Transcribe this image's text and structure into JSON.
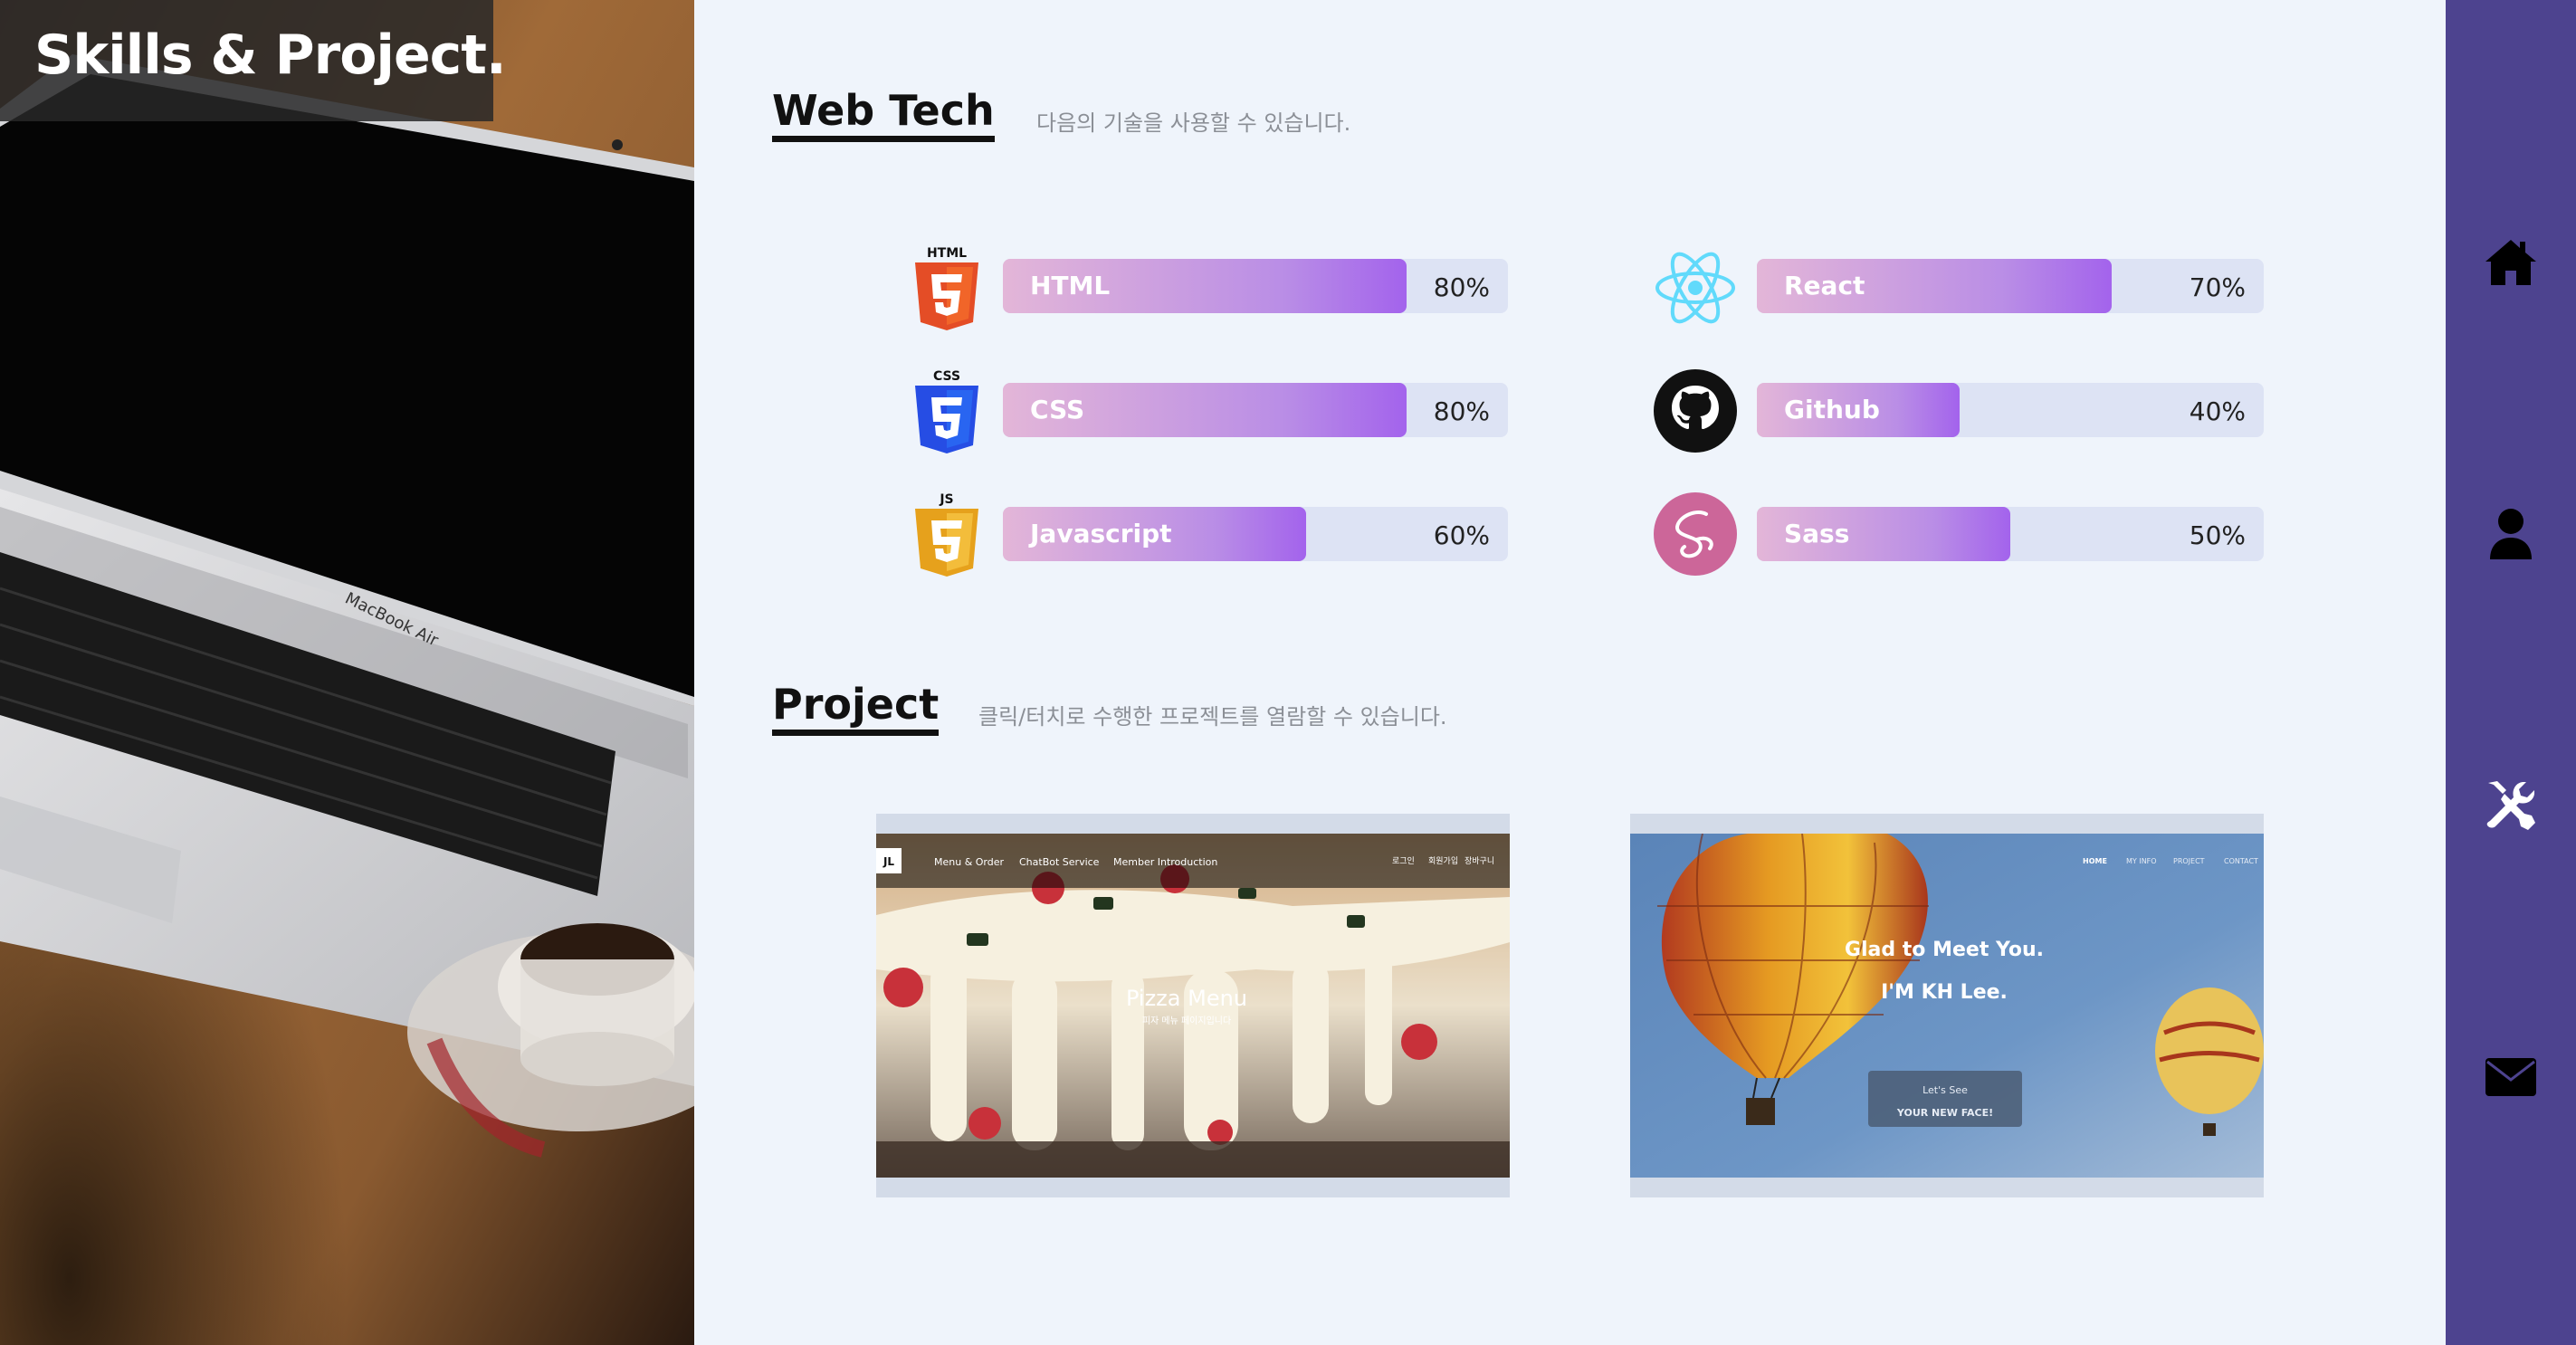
{
  "hero": {
    "title": "Skills & Project.",
    "laptop_brand": "MacBook Air"
  },
  "webtech": {
    "heading": "Web Tech",
    "subtitle": "다음의 기술을 사용할 수 있습니다.",
    "skills": [
      {
        "name": "HTML",
        "percent": "80%",
        "value": 0.8,
        "icon": "html5-icon",
        "icon_label": "HTML",
        "icon_color": "#e44d26"
      },
      {
        "name": "CSS",
        "percent": "80%",
        "value": 0.8,
        "icon": "css3-icon",
        "icon_label": "CSS",
        "icon_color": "#264de4"
      },
      {
        "name": "Javascript",
        "percent": "60%",
        "value": 0.6,
        "icon": "javascript-icon",
        "icon_label": "JS",
        "icon_color": "#f0b429"
      },
      {
        "name": "React",
        "percent": "70%",
        "value": 0.7,
        "icon": "react-icon",
        "icon_color": "#61dafb"
      },
      {
        "name": "Github",
        "percent": "40%",
        "value": 0.4,
        "icon": "github-icon",
        "icon_color": "#111111"
      },
      {
        "name": "Sass",
        "percent": "50%",
        "value": 0.5,
        "icon": "sass-icon",
        "icon_color": "#cc6699"
      }
    ]
  },
  "project": {
    "heading": "Project",
    "subtitle": "클릭/터치로 수행한 프로젝트를 열람할 수 있습니다.",
    "cards": [
      {
        "name": "pizza",
        "logo": "JL",
        "nav": [
          "Menu & Order",
          "ChatBot Service",
          "Member Introduction"
        ],
        "nav_right": [
          "로그인",
          "회원가입",
          "장바구니"
        ],
        "title": "Pizza Menu",
        "caption": "피자 메뉴 페이지입니다"
      },
      {
        "name": "portfolio",
        "nav": [
          "HOME",
          "MY INFO",
          "PROJECT",
          "CONTACT"
        ],
        "headline": "Glad to Meet You.",
        "subline": "I'M KH Lee.",
        "cta_line1": "Let's See",
        "cta_line2": "YOUR NEW FACE!"
      }
    ]
  },
  "nav": {
    "items": [
      "home-icon",
      "user-icon",
      "tools-icon",
      "mail-icon"
    ]
  },
  "colors": {
    "nav_bg": "#4d438f",
    "main_bg": "#eff4fb",
    "bar_track": "#dde3f4",
    "bar_fill_start": "#e3b6d8",
    "bar_fill_end": "#a363ec"
  }
}
